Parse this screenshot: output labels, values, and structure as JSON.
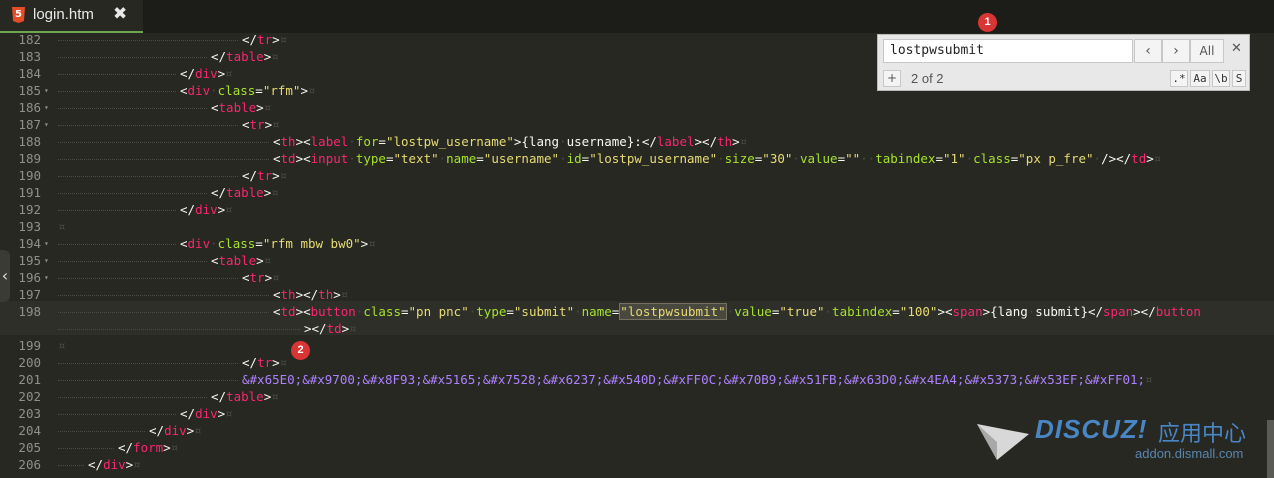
{
  "tab": {
    "filename": "login.htm",
    "close_glyph": "✖",
    "icon_label": "5"
  },
  "find": {
    "query": "lostpwsubmit",
    "prev_glyph": "‹",
    "next_glyph": "›",
    "all_label": "All",
    "close_glyph": "✕",
    "add_glyph": "+",
    "count": "2 of 2",
    "opt_regex": ".*",
    "opt_case": "Aa",
    "opt_word": "\\b",
    "opt_selection": "S"
  },
  "badges": {
    "b1": "1",
    "b2": "2"
  },
  "watermark": {
    "brand": "DISCUZ!",
    "cn": "应用中心",
    "url": "addon.dismall.com"
  },
  "lines": [
    {
      "n": "182",
      "fold": "",
      "segs": [
        [
          "t",
          "</"
        ],
        [
          "tg",
          "tr"
        ],
        [
          "t",
          ">"
        ],
        [
          "ws",
          "¤"
        ]
      ]
    },
    {
      "n": "183",
      "fold": "",
      "segs": [
        [
          "t",
          "</"
        ],
        [
          "tg",
          "table"
        ],
        [
          "t",
          ">"
        ],
        [
          "ws",
          "¤"
        ]
      ]
    },
    {
      "n": "184",
      "fold": "",
      "segs": [
        [
          "t",
          "</"
        ],
        [
          "tg",
          "div"
        ],
        [
          "t",
          ">"
        ],
        [
          "ws",
          "¤"
        ]
      ]
    },
    {
      "n": "185",
      "fold": "▾",
      "segs": [
        [
          "t",
          "<"
        ],
        [
          "tg",
          "div"
        ],
        [
          "ws",
          "·"
        ],
        [
          "at",
          "class"
        ],
        [
          "t",
          "="
        ],
        [
          "st",
          "\"rfm\""
        ],
        [
          "t",
          ">"
        ],
        [
          "ws",
          "¤"
        ]
      ]
    },
    {
      "n": "186",
      "fold": "▾",
      "segs": [
        [
          "t",
          "<"
        ],
        [
          "tg",
          "table"
        ],
        [
          "t",
          ">"
        ],
        [
          "ws",
          "¤"
        ]
      ]
    },
    {
      "n": "187",
      "fold": "▾",
      "segs": [
        [
          "t",
          "<"
        ],
        [
          "tg",
          "tr"
        ],
        [
          "t",
          ">"
        ],
        [
          "ws",
          "¤"
        ]
      ]
    },
    {
      "n": "188",
      "fold": "",
      "segs": [
        [
          "t",
          "<"
        ],
        [
          "tg",
          "th"
        ],
        [
          "t",
          "><"
        ],
        [
          "tg",
          "label"
        ],
        [
          "ws",
          "·"
        ],
        [
          "at",
          "for"
        ],
        [
          "t",
          "="
        ],
        [
          "st",
          "\"lostpw_username\""
        ],
        [
          "t",
          ">{lang"
        ],
        [
          "ws",
          "·"
        ],
        [
          "t",
          "username}:</"
        ],
        [
          "tg",
          "label"
        ],
        [
          "t",
          "></"
        ],
        [
          "tg",
          "th"
        ],
        [
          "t",
          ">"
        ],
        [
          "ws",
          "¤"
        ]
      ]
    },
    {
      "n": "189",
      "fold": "",
      "segs": [
        [
          "t",
          "<"
        ],
        [
          "tg",
          "td"
        ],
        [
          "t",
          "><"
        ],
        [
          "tg",
          "input"
        ],
        [
          "ws",
          "·"
        ],
        [
          "at",
          "type"
        ],
        [
          "t",
          "="
        ],
        [
          "st",
          "\"text\""
        ],
        [
          "ws",
          "·"
        ],
        [
          "at",
          "name"
        ],
        [
          "t",
          "="
        ],
        [
          "st",
          "\"username\""
        ],
        [
          "ws",
          "·"
        ],
        [
          "at",
          "id"
        ],
        [
          "t",
          "="
        ],
        [
          "st",
          "\"lostpw_username\""
        ],
        [
          "ws",
          "·"
        ],
        [
          "at",
          "size"
        ],
        [
          "t",
          "="
        ],
        [
          "st",
          "\"30\""
        ],
        [
          "ws",
          "·"
        ],
        [
          "at",
          "value"
        ],
        [
          "t",
          "="
        ],
        [
          "st",
          "\"\""
        ],
        [
          "ws",
          "··"
        ],
        [
          "at",
          "tabindex"
        ],
        [
          "t",
          "="
        ],
        [
          "st",
          "\"1\""
        ],
        [
          "ws",
          "·"
        ],
        [
          "at",
          "class"
        ],
        [
          "t",
          "="
        ],
        [
          "st",
          "\"px p_fre\""
        ],
        [
          "ws",
          "·"
        ],
        [
          "t",
          "/></"
        ],
        [
          "tg",
          "td"
        ],
        [
          "t",
          ">"
        ],
        [
          "ws",
          "¤"
        ]
      ]
    },
    {
      "n": "190",
      "fold": "",
      "segs": [
        [
          "t",
          "</"
        ],
        [
          "tg",
          "tr"
        ],
        [
          "t",
          ">"
        ],
        [
          "ws",
          "¤"
        ]
      ]
    },
    {
      "n": "191",
      "fold": "",
      "segs": [
        [
          "t",
          "</"
        ],
        [
          "tg",
          "table"
        ],
        [
          "t",
          ">"
        ],
        [
          "ws",
          "¤"
        ]
      ]
    },
    {
      "n": "192",
      "fold": "",
      "segs": [
        [
          "t",
          "</"
        ],
        [
          "tg",
          "div"
        ],
        [
          "t",
          ">"
        ],
        [
          "ws",
          "¤"
        ]
      ]
    },
    {
      "n": "193",
      "fold": "",
      "segs": [
        [
          "ws",
          "¤"
        ]
      ]
    },
    {
      "n": "194",
      "fold": "▾",
      "segs": [
        [
          "t",
          "<"
        ],
        [
          "tg",
          "div"
        ],
        [
          "ws",
          "·"
        ],
        [
          "at",
          "class"
        ],
        [
          "t",
          "="
        ],
        [
          "st",
          "\"rfm mbw bw0\""
        ],
        [
          "t",
          ">"
        ],
        [
          "ws",
          "¤"
        ]
      ]
    },
    {
      "n": "195",
      "fold": "▾",
      "segs": [
        [
          "t",
          "<"
        ],
        [
          "tg",
          "table"
        ],
        [
          "t",
          ">"
        ],
        [
          "ws",
          "¤"
        ]
      ]
    },
    {
      "n": "196",
      "fold": "▾",
      "segs": [
        [
          "t",
          "<"
        ],
        [
          "tg",
          "tr"
        ],
        [
          "t",
          ">"
        ],
        [
          "ws",
          "¤"
        ]
      ]
    },
    {
      "n": "197",
      "fold": "",
      "segs": [
        [
          "t",
          "<"
        ],
        [
          "tg",
          "th"
        ],
        [
          "t",
          "></"
        ],
        [
          "tg",
          "th"
        ],
        [
          "t",
          ">"
        ],
        [
          "ws",
          "¤"
        ]
      ]
    },
    {
      "n": "198",
      "fold": "",
      "segs": [
        [
          "t",
          "<"
        ],
        [
          "tg",
          "td"
        ],
        [
          "t",
          "><"
        ],
        [
          "tg",
          "button"
        ],
        [
          "ws",
          "·"
        ],
        [
          "at",
          "class"
        ],
        [
          "t",
          "="
        ],
        [
          "st",
          "\"pn pnc\""
        ],
        [
          "ws",
          "·"
        ],
        [
          "at",
          "type"
        ],
        [
          "t",
          "="
        ],
        [
          "st",
          "\"submit\""
        ],
        [
          "ws",
          "·"
        ],
        [
          "at",
          "name"
        ],
        [
          "t",
          "="
        ],
        [
          "hl",
          "\"lostpwsubmit\""
        ],
        [
          "ws",
          "·"
        ],
        [
          "at",
          "value"
        ],
        [
          "t",
          "="
        ],
        [
          "st",
          "\"true\""
        ],
        [
          "ws",
          "·"
        ],
        [
          "at",
          "tabindex"
        ],
        [
          "t",
          "="
        ],
        [
          "st",
          "\"100\""
        ],
        [
          "t",
          "><"
        ],
        [
          "tg",
          "span"
        ],
        [
          "t",
          ">{lang"
        ],
        [
          "ws",
          "·"
        ],
        [
          "t",
          "submit}</"
        ],
        [
          "tg",
          "span"
        ],
        [
          "t",
          "></"
        ],
        [
          "tg",
          "button"
        ]
      ]
    },
    {
      "n": "",
      "fold": "",
      "segs": [
        [
          "t",
          "></"
        ],
        [
          "tg",
          "td"
        ],
        [
          "t",
          ">"
        ],
        [
          "ws",
          "¤"
        ]
      ]
    },
    {
      "n": "199",
      "fold": "",
      "segs": [
        [
          "ws",
          "¤"
        ]
      ]
    },
    {
      "n": "200",
      "fold": "",
      "segs": [
        [
          "t",
          "</"
        ],
        [
          "tg",
          "tr"
        ],
        [
          "t",
          ">"
        ],
        [
          "ws",
          "¤"
        ]
      ]
    },
    {
      "n": "201",
      "fold": "",
      "segs": [
        [
          "ent",
          "&#x65E0;&#x9700;&#x8F93;&#x5165;&#x7528;&#x6237;&#x540D;&#xFF0C;&#x70B9;&#x51FB;&#x63D0;&#x4EA4;&#x5373;&#x53EF;&#xFF01;"
        ],
        [
          "ws",
          "¤"
        ]
      ]
    },
    {
      "n": "202",
      "fold": "",
      "segs": [
        [
          "t",
          "</"
        ],
        [
          "tg",
          "table"
        ],
        [
          "t",
          ">"
        ],
        [
          "ws",
          "¤"
        ]
      ]
    },
    {
      "n": "203",
      "fold": "",
      "segs": [
        [
          "t",
          "</"
        ],
        [
          "tg",
          "div"
        ],
        [
          "t",
          ">"
        ],
        [
          "ws",
          "¤"
        ]
      ]
    },
    {
      "n": "204",
      "fold": "",
      "segs": [
        [
          "t",
          "</"
        ],
        [
          "tg",
          "div"
        ],
        [
          "t",
          ">"
        ],
        [
          "ws",
          "¤"
        ]
      ]
    },
    {
      "n": "205",
      "fold": "",
      "segs": [
        [
          "t",
          "</"
        ],
        [
          "tg",
          "form"
        ],
        [
          "t",
          ">"
        ],
        [
          "ws",
          "¤"
        ]
      ]
    },
    {
      "n": "206",
      "fold": "",
      "segs": [
        [
          "t",
          "</"
        ],
        [
          "tg",
          "div"
        ],
        [
          "t",
          ">"
        ],
        [
          "ws",
          "¤"
        ]
      ]
    }
  ]
}
